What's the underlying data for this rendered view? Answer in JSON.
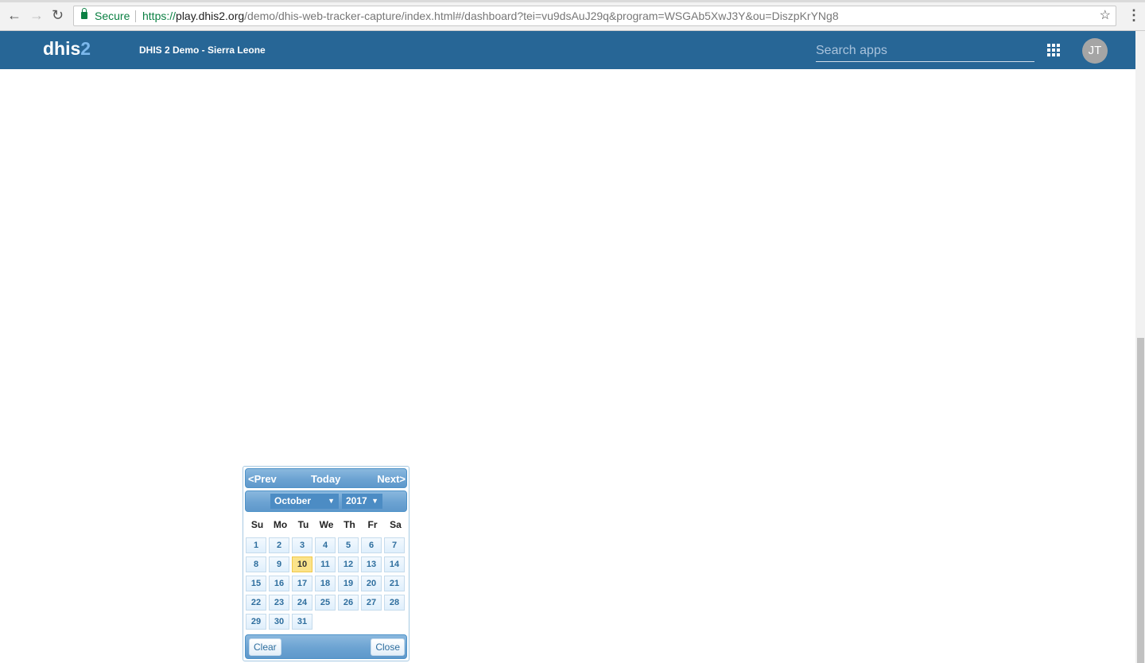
{
  "browser": {
    "secure_label": "Secure",
    "url_scheme": "https://",
    "url_host": "play.dhis2.org",
    "url_path": "/demo/dhis-web-tracker-capture/index.html#/dashboard?tei=vu9dsAuJ29q&program=WSGAb5XwJ3Y&ou=DiszpKrYNg8"
  },
  "header": {
    "logo_text": "dhis",
    "logo_accent": "2",
    "title": "DHIS 2 Demo - Sierra Leone",
    "search_placeholder": "Search apps",
    "avatar_initials": "JT",
    "color": "#276696"
  },
  "datepicker": {
    "prev": "<Prev",
    "today": "Today",
    "next": "Next>",
    "month": "October",
    "year": "2017",
    "weekdays": [
      "Su",
      "Mo",
      "Tu",
      "We",
      "Th",
      "Fr",
      "Sa"
    ],
    "days": [
      "1",
      "2",
      "3",
      "4",
      "5",
      "6",
      "7",
      "8",
      "9",
      "10",
      "11",
      "12",
      "13",
      "14",
      "15",
      "16",
      "17",
      "18",
      "19",
      "20",
      "21",
      "22",
      "23",
      "24",
      "25",
      "26",
      "27",
      "28",
      "29",
      "30",
      "31"
    ],
    "selected_day": "10",
    "clear": "Clear",
    "close": "Close"
  }
}
